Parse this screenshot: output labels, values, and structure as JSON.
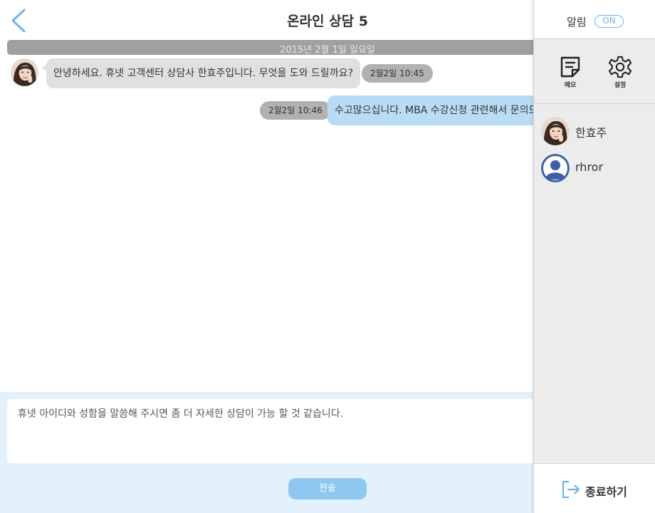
{
  "header": {
    "title": "온라인 상담 5",
    "back_icon": "chevron-left-icon"
  },
  "chat": {
    "date_divider": "2015년 2월 1일 일요일",
    "messages": [
      {
        "direction": "incoming",
        "text": "안녕하세요. 휴넷 고객센터 상담사 한효주입니다. 무엇을 도와 드릴까요?",
        "time": "2월2일 10:45"
      },
      {
        "direction": "outgoing",
        "text": "수고많으십니다. MBA 수강신청 관련해서 문의드",
        "time": "2월2일 10:46"
      }
    ]
  },
  "composer": {
    "value": "휴넷 아이디와 성함을 말씀해 주시면 좀 더 자세한 상담이 가능 할 것 같습니다.",
    "send_label": "전송"
  },
  "sidebar": {
    "notification_label": "알림",
    "notification_state": "ON",
    "tools": [
      {
        "label": "메모",
        "icon": "memo-icon"
      },
      {
        "label": "설정",
        "icon": "gear-icon"
      }
    ],
    "participants": [
      {
        "name": "한효주",
        "avatar": "photo"
      },
      {
        "name": "rhror",
        "avatar": "default-user-icon"
      }
    ],
    "exit_label": "종료하기",
    "exit_icon": "logout-icon"
  },
  "colors": {
    "accent": "#6fb3e6",
    "outgoing_bubble": "#b9dcf6",
    "incoming_bubble": "#e0e0e0",
    "input_panel": "#e3f1fc",
    "send_button": "#8ec7f2",
    "default_avatar": "#3d5fa3"
  }
}
